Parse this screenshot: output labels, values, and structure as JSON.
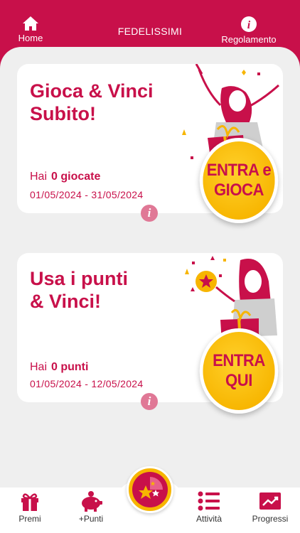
{
  "header": {
    "title": "FEDELISSIMI",
    "home_label": "Home",
    "rules_label": "Regolamento"
  },
  "cards": [
    {
      "title_line1": "Gioca & Vinci",
      "title_line2": "Subito!",
      "count_prefix": "Hai",
      "count_value": "0 giocate",
      "dates": "01/05/2024 - 31/05/2024",
      "cta_line1": "ENTRA e",
      "cta_line2": "GIOCA"
    },
    {
      "title_line1": "Usa i punti",
      "title_line2": "& Vinci!",
      "count_prefix": "Hai",
      "count_value": "0 punti",
      "dates": "01/05/2024 - 12/05/2024",
      "cta_line1": "ENTRA",
      "cta_line2": "QUI"
    }
  ],
  "tabs": {
    "premi": "Premi",
    "punti": "+Punti",
    "attivita": "Attività",
    "progressi": "Progressi"
  },
  "colors": {
    "brand": "#c8104a",
    "accent": "#f7b500",
    "background": "#efefef"
  }
}
